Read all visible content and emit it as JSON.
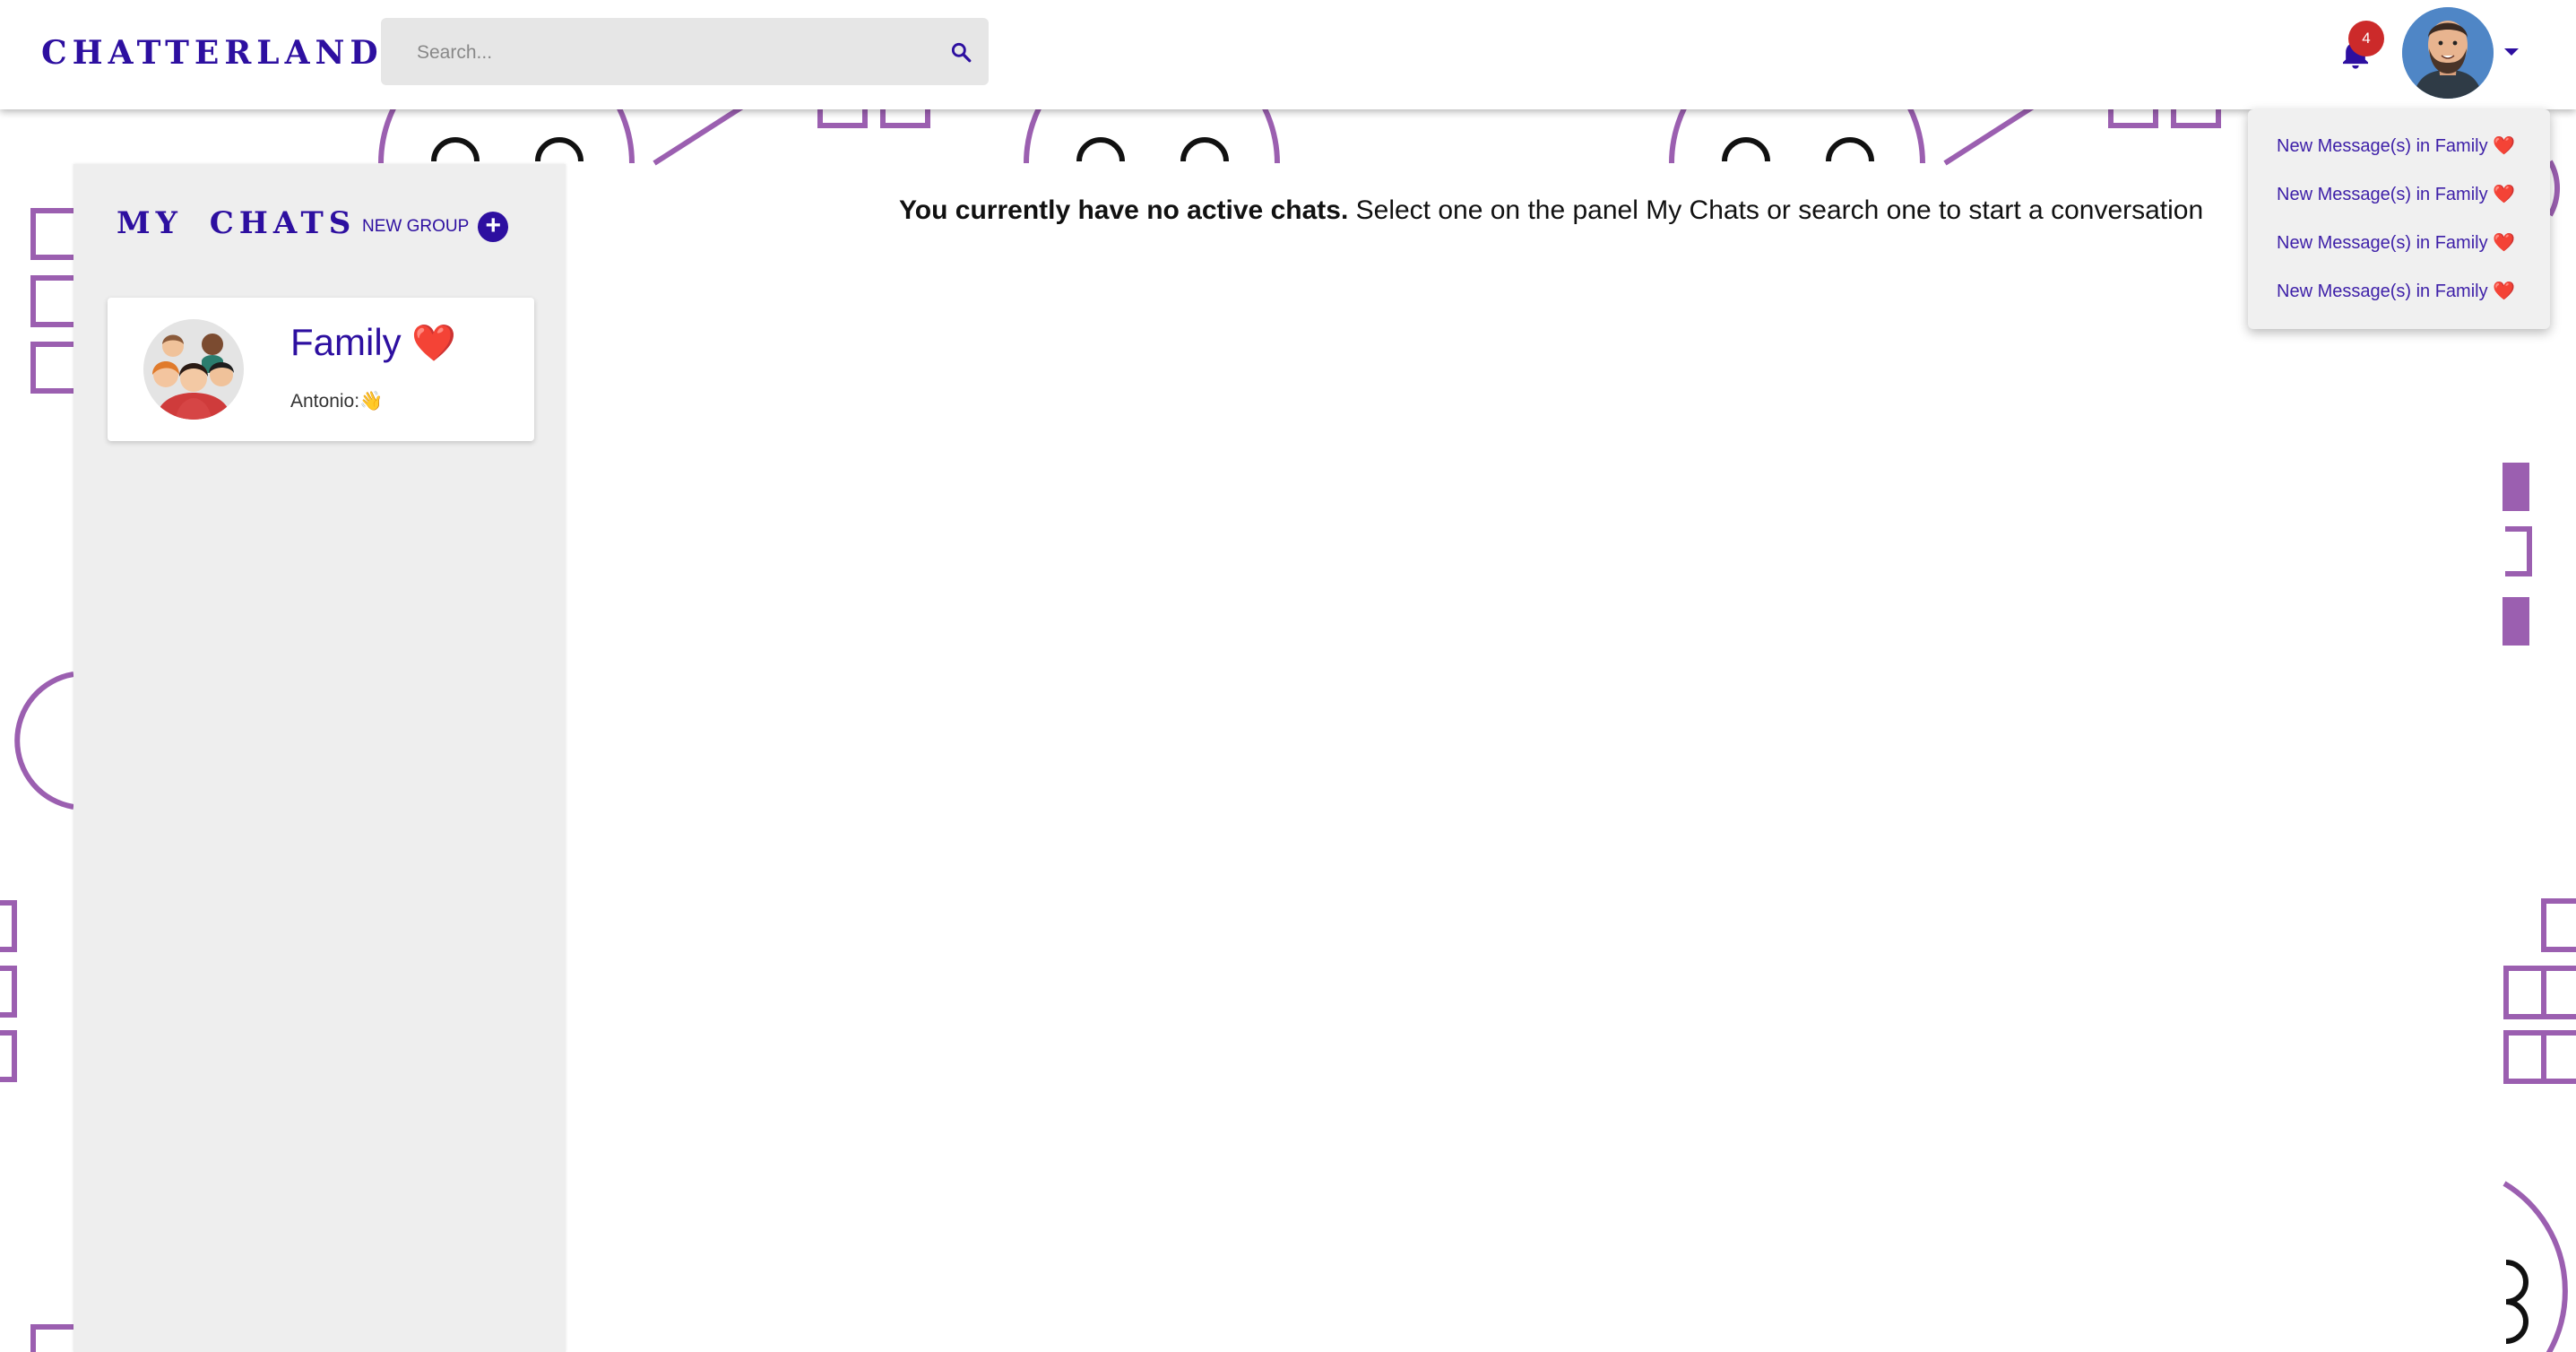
{
  "brand": {
    "name": "CHATTERLAND",
    "accent_color": "#2d0fa0"
  },
  "search": {
    "placeholder": "Search...",
    "icon": "search-icon"
  },
  "notifications": {
    "count": "4",
    "icon": "bell-icon",
    "items": [
      {
        "text": "New Message(s) in Family",
        "emoji": "❤️"
      },
      {
        "text": "New Message(s) in Family",
        "emoji": "❤️"
      },
      {
        "text": "New Message(s) in Family",
        "emoji": "❤️"
      },
      {
        "text": "New Message(s) in Family",
        "emoji": "❤️"
      }
    ]
  },
  "user": {
    "avatar_icon": "user-avatar",
    "menu_icon": "caret-down-icon"
  },
  "chats": {
    "title": "MY CHATS",
    "new_group_label": "NEW GROUP",
    "new_group_icon": "plus-circle-icon",
    "items": [
      {
        "name": "Family",
        "emoji": "❤️",
        "last_sender": "Antonio:",
        "last_message": "👋"
      }
    ]
  },
  "main": {
    "empty_bold": "You currently have no active chats.",
    "empty_rest": " Select one on the panel My Chats or search one to start a conversation"
  }
}
